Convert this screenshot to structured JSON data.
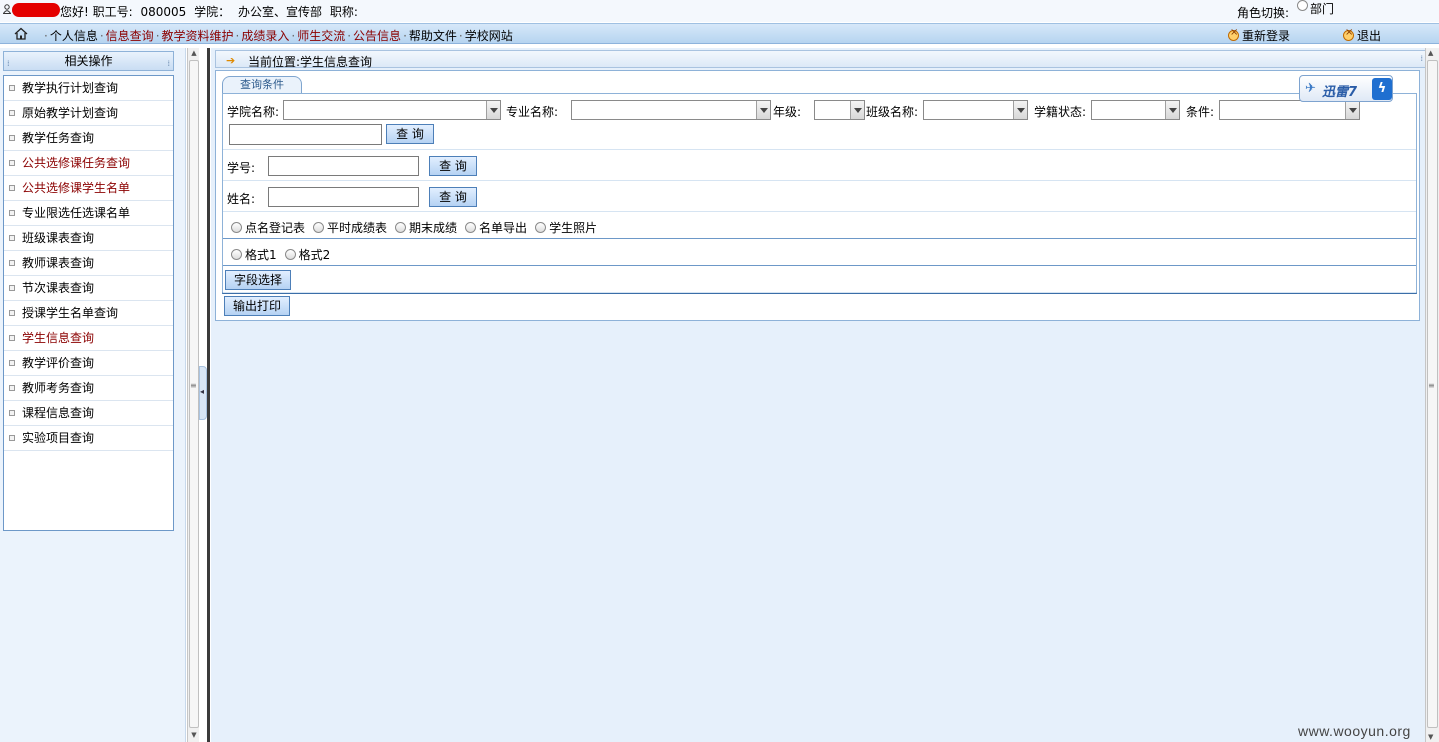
{
  "userbar": {
    "greeting": "您好! 职工号:",
    "staff_id": "080005",
    "college_label": "学院：",
    "college_value": "办公室、宣传部",
    "title_label": "职称:",
    "role_switch_label": "角色切换:",
    "role_option": "部门"
  },
  "nav": {
    "items": [
      {
        "label": "个人信息",
        "color": "#000000"
      },
      {
        "label": "信息查询",
        "color": "#8b0000"
      },
      {
        "label": "教学资料维护",
        "color": "#8b0000"
      },
      {
        "label": "成绩录入",
        "color": "#8b0000"
      },
      {
        "label": "师生交流",
        "color": "#8b0000"
      },
      {
        "label": "公告信息",
        "color": "#8b0000"
      },
      {
        "label": "帮助文件",
        "color": "#000000"
      },
      {
        "label": "学校网站",
        "color": "#000000"
      }
    ],
    "relogin": "重新登录",
    "logout": "退出"
  },
  "sidebar": {
    "title": "相关操作",
    "items": [
      {
        "label": "教学执行计划查询",
        "highlight": false
      },
      {
        "label": "原始教学计划查询",
        "highlight": false
      },
      {
        "label": "教学任务查询",
        "highlight": false
      },
      {
        "label": "公共选修课任务查询",
        "highlight": true
      },
      {
        "label": "公共选修课学生名单",
        "highlight": true
      },
      {
        "label": "专业限选任选课名单",
        "highlight": false
      },
      {
        "label": "班级课表查询",
        "highlight": false
      },
      {
        "label": "教师课表查询",
        "highlight": false
      },
      {
        "label": "节次课表查询",
        "highlight": false
      },
      {
        "label": "授课学生名单查询",
        "highlight": false
      },
      {
        "label": "学生信息查询",
        "highlight": true
      },
      {
        "label": "教学评价查询",
        "highlight": false
      },
      {
        "label": "教师考务查询",
        "highlight": false
      },
      {
        "label": "课程信息查询",
        "highlight": false
      },
      {
        "label": "实验项目查询",
        "highlight": false
      }
    ]
  },
  "breadcrumb": "当前位置:学生信息查询",
  "form": {
    "tab": "查询条件",
    "college_label": "学院名称:",
    "college_value": "",
    "major_label": "专业名称:",
    "major_value": "",
    "grade_label": "年级:",
    "grade_value": "",
    "class_label": "班级名称:",
    "class_value": "",
    "status_label": "学籍状态:",
    "status_value": "",
    "condition_label": "条件:",
    "condition_value": "",
    "condition_text": "",
    "query_btn": "查 询",
    "student_id_label": "学号:",
    "student_id_value": "",
    "name_label": "姓名:",
    "name_value": "",
    "report_options": [
      "点名登记表",
      "平时成绩表",
      "期末成绩",
      "名单导出",
      "学生照片"
    ],
    "format_options": [
      "格式1",
      "格式2"
    ],
    "field_select_btn": "字段选择",
    "print_btn": "输出打印"
  },
  "xunlei": {
    "label": "迅雷7",
    "icon": "lightning-icon"
  },
  "watermark": "www.wooyun.org",
  "colors": {
    "accent": "#8b0000",
    "nav_bg": "#c6def5",
    "panel_bg": "#e6f0fb"
  }
}
